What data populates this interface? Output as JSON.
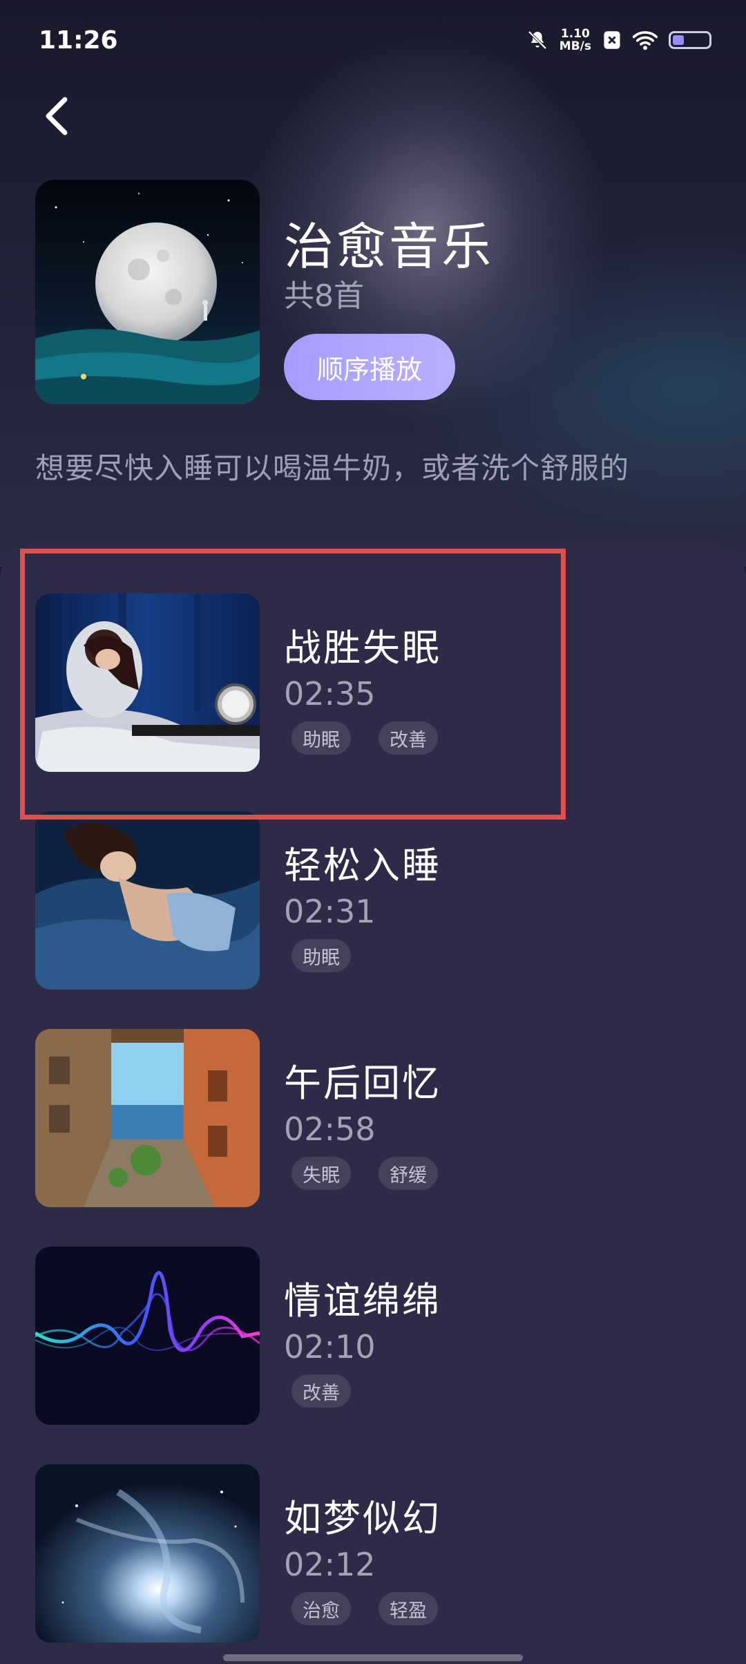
{
  "status_bar": {
    "time": "11:26",
    "net_speed_value": "1.10",
    "net_speed_unit": "MB/s",
    "icons": [
      "bell-off-icon",
      "close-box-icon",
      "wifi-icon",
      "battery-icon"
    ]
  },
  "header": {
    "back_icon": "chevron-left-icon",
    "album_title": "治愈音乐",
    "album_count": "共8首",
    "play_button": "顺序播放",
    "description": "想要尽快入睡可以喝温牛奶，或者洗个舒服的"
  },
  "songs": [
    {
      "title": "战胜失眠",
      "duration": "02:35",
      "tags": [
        "助眠",
        "改善"
      ],
      "thumb": "insomnia-woman-image"
    },
    {
      "title": "轻松入睡",
      "duration": "02:31",
      "tags": [
        "助眠"
      ],
      "thumb": "sleeping-woman-image"
    },
    {
      "title": "午后回忆",
      "duration": "02:58",
      "tags": [
        "失眠",
        "舒缓"
      ],
      "thumb": "alley-street-image"
    },
    {
      "title": "情谊绵绵",
      "duration": "02:10",
      "tags": [
        "改善"
      ],
      "thumb": "sound-wave-image"
    },
    {
      "title": "如梦似幻",
      "duration": "02:12",
      "tags": [
        "治愈",
        "轻盈"
      ],
      "thumb": "galaxy-image"
    }
  ],
  "colors": {
    "accent": "#a79cff",
    "list_background": "#2d2b47",
    "highlight_border": "#e24e4b"
  }
}
